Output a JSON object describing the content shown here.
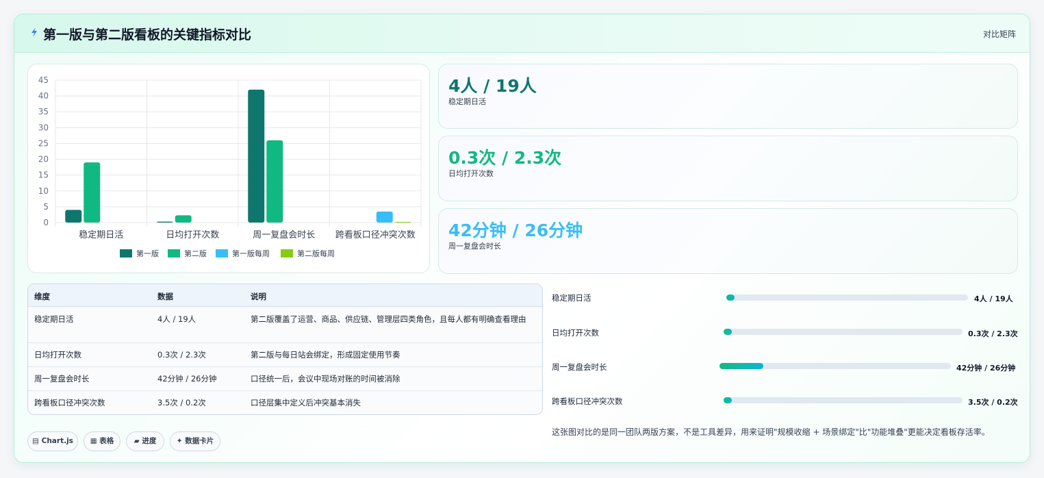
{
  "header": {
    "title": "第一版与第二版看板的关键指标对比",
    "tag": "对比矩阵"
  },
  "colors": {
    "v1": "#0f766e",
    "v2": "#10b981",
    "v1_weekly": "#38bdf8",
    "v2_weekly": "#84cc16",
    "kpi1": "#0f766e",
    "kpi2": "#10b981",
    "kpi3": "#38bdf8"
  },
  "chart_data": {
    "type": "bar",
    "categories": [
      "稳定期日活",
      "日均打开次数",
      "周一复盘会时长",
      "跨看板口径冲突次数"
    ],
    "series": [
      {
        "name": "第一版",
        "values": [
          4,
          0.3,
          42,
          null
        ]
      },
      {
        "name": "第二版",
        "values": [
          19,
          2.3,
          26,
          null
        ]
      },
      {
        "name": "第一版每周",
        "values": [
          null,
          null,
          null,
          3.5
        ]
      },
      {
        "name": "第二版每周",
        "values": [
          null,
          null,
          null,
          0.2
        ]
      }
    ],
    "ylim": [
      0,
      45
    ],
    "yticks": [
      0,
      5,
      10,
      15,
      20,
      25,
      30,
      35,
      40,
      45
    ],
    "grid": true,
    "legend_position": "bottom"
  },
  "kpis": [
    {
      "value": "4人 / 19人",
      "label": "稳定期日活"
    },
    {
      "value": "0.3次 / 2.3次",
      "label": "日均打开次数"
    },
    {
      "value": "42分钟 / 26分钟",
      "label": "周一复盘会时长"
    }
  ],
  "table": {
    "headers": [
      "维度",
      "数据",
      "说明"
    ],
    "rows": [
      {
        "dimension": "稳定期日活",
        "data": "4人 / 19人",
        "note": "第二版覆盖了运营、商品、供应链、管理层四类角色，且每人都有明确查看理由"
      },
      {
        "dimension": "日均打开次数",
        "data": "0.3次 / 2.3次",
        "note": "第二版与每日站会绑定，形成固定使用节奏"
      },
      {
        "dimension": "周一复盘会时长",
        "data": "42分钟 / 26分钟",
        "note": "口径统一后，会议中现场对账的时间被消除"
      },
      {
        "dimension": "跨看板口径冲突次数",
        "data": "3.5次 / 0.2次",
        "note": "口径层集中定义后冲突基本消失"
      }
    ]
  },
  "progress": [
    {
      "label": "稳定期日活",
      "value": "4人 / 19人",
      "fill_fraction": 0.02
    },
    {
      "label": "日均打开次数",
      "value": "0.3次 / 2.3次",
      "fill_fraction": 0.02
    },
    {
      "label": "周一复盘会时长",
      "value": "42分钟 / 26分钟",
      "fill_fraction": 0.19
    },
    {
      "label": "跨看板口径冲突次数",
      "value": "3.5次 / 0.2次",
      "fill_fraction": 0.02
    }
  ],
  "chips": [
    {
      "icon": "chart-icon",
      "label": "Chart.js"
    },
    {
      "icon": "table-icon",
      "label": "表格"
    },
    {
      "icon": "folder-icon",
      "label": "进度"
    },
    {
      "icon": "sparkle-icon",
      "label": "数据卡片"
    }
  ],
  "note": "这张图对比的是同一团队两版方案，不是工具差异，用来证明\"规模收缩 + 场景绑定\"比\"功能堆叠\"更能决定看板存活率。"
}
